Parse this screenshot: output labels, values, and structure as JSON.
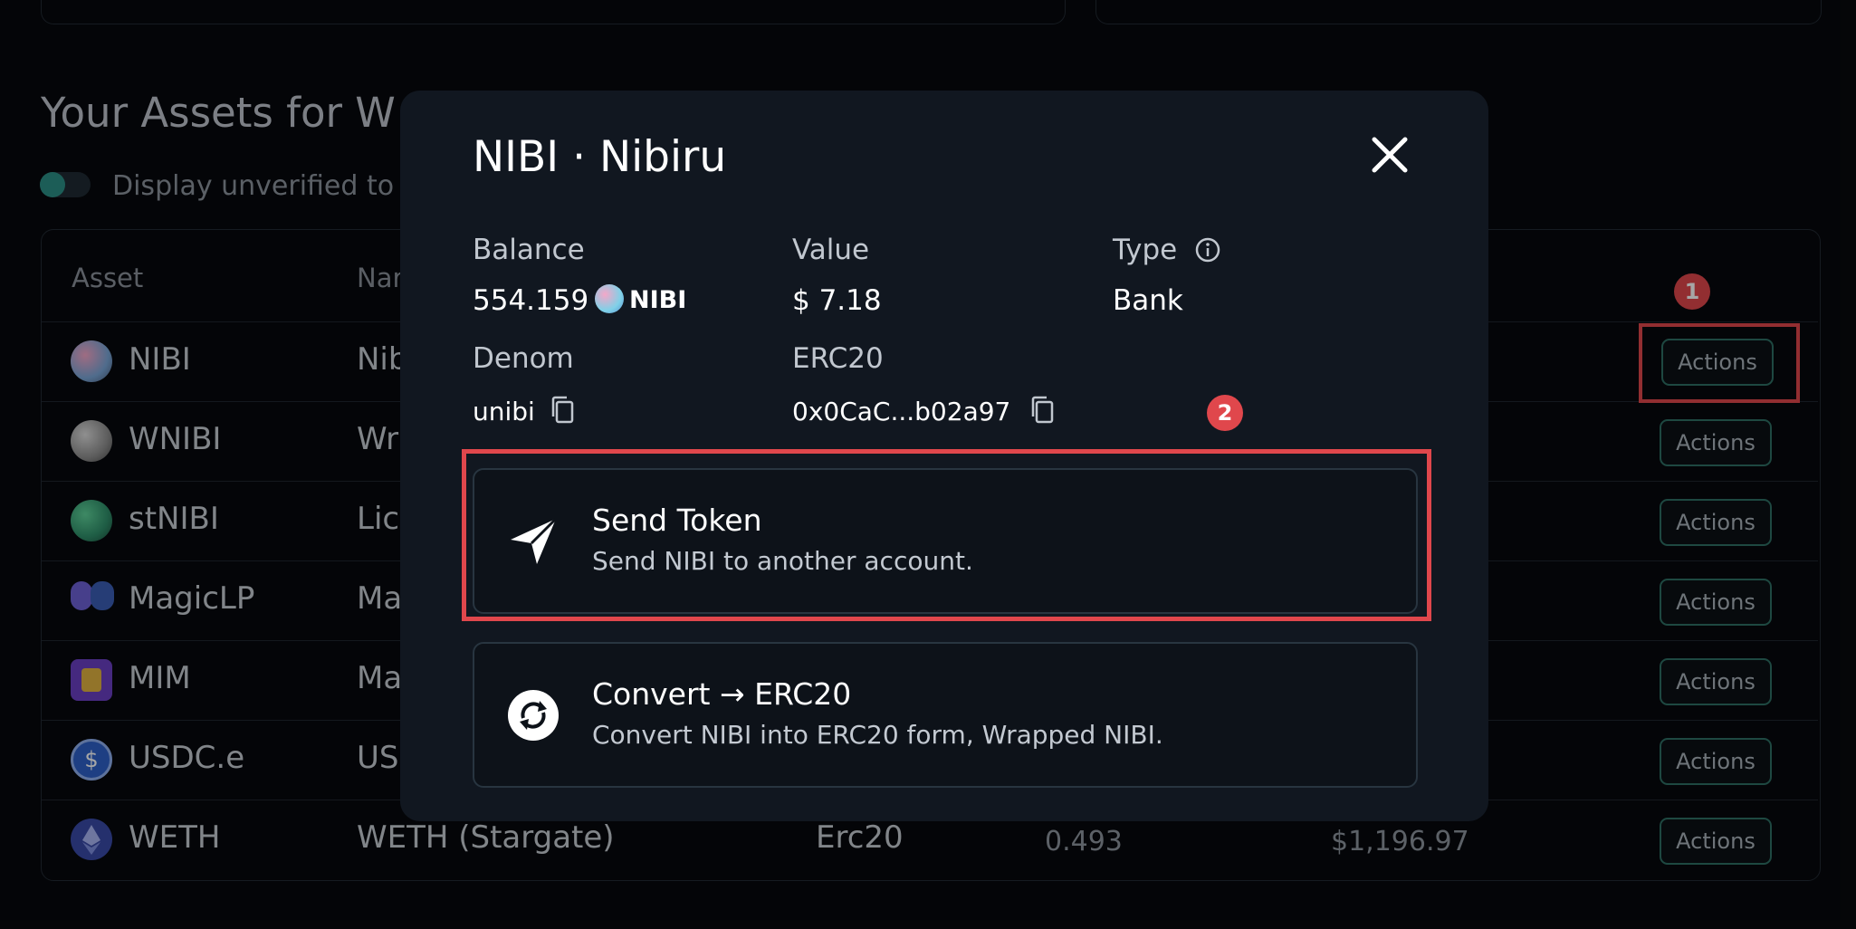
{
  "page": {
    "title": "Your Assets for W",
    "toggle_label": "Display unverified to"
  },
  "table": {
    "headers": {
      "asset": "Asset",
      "name": "Nar"
    },
    "rows": [
      {
        "symbol": "NIBI",
        "name": "Nib",
        "type": "",
        "balance": "",
        "value": "",
        "action": "Actions"
      },
      {
        "symbol": "WNIBI",
        "name": "Wra",
        "type": "",
        "balance": "",
        "value": "",
        "action": "Actions"
      },
      {
        "symbol": "stNIBI",
        "name": "Lic",
        "type": "",
        "balance": "",
        "value": "",
        "action": "Actions"
      },
      {
        "symbol": "MagicLP",
        "name": "Ma",
        "type": "",
        "balance": "",
        "value": "",
        "action": "Actions"
      },
      {
        "symbol": "MIM",
        "name": "Ma",
        "type": "",
        "balance": "",
        "value": "",
        "action": "Actions"
      },
      {
        "symbol": "USDC.e",
        "name": "US",
        "type": "",
        "balance": "",
        "value": "",
        "action": "Actions"
      },
      {
        "symbol": "WETH",
        "name": "WETH (Stargate)",
        "type": "Erc20",
        "balance": "0.493",
        "value": "$1,196.97",
        "action": "Actions"
      }
    ]
  },
  "annotations": {
    "badge1": "1",
    "badge2": "2",
    "highlight_color": "#e0474c"
  },
  "modal": {
    "title": "NIBI · Nibiru",
    "balance_label": "Balance",
    "balance_value": "554.159",
    "balance_token": "NIBI",
    "value_label": "Value",
    "value_value": "$ 7.18",
    "type_label": "Type",
    "type_value": "Bank",
    "denom_label": "Denom",
    "denom_value": "unibi",
    "erc20_label": "ERC20",
    "erc20_value": "0x0CaC...b02a97",
    "actions": [
      {
        "title": "Send Token",
        "description": "Send NIBI to another account.",
        "icon": "send-icon"
      },
      {
        "title": "Convert → ERC20",
        "description": "Convert NIBI into ERC20 form, Wrapped NIBI.",
        "icon": "convert-icon"
      }
    ]
  },
  "colors": {
    "accent": "#2f6f65",
    "background": "#07090d",
    "modal_bg": "#111720"
  }
}
